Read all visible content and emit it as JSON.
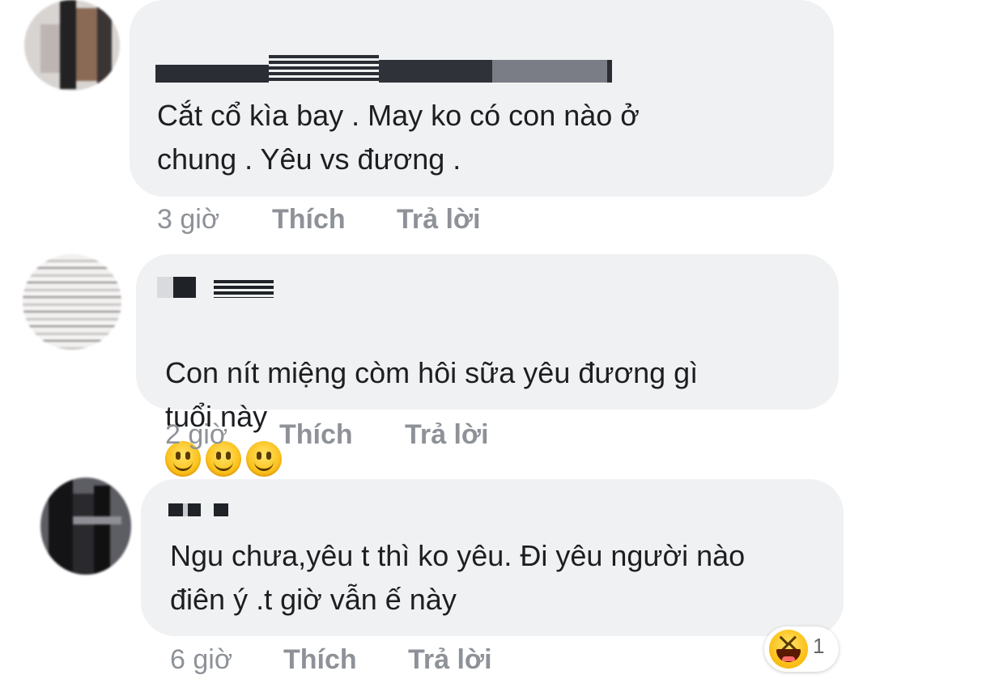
{
  "comments": [
    {
      "text": "Cắt cổ kìa bay . May ko có con nào ở\nchung . Yêu vs đương .",
      "time": "3 giờ",
      "like": "Thích",
      "reply": "Trả lời"
    },
    {
      "text": "Con nít miệng còm hôi sữa yêu đương gì\ntuổi này",
      "emojis": [
        "slightly-smiling-face",
        "slightly-smiling-face",
        "slightly-smiling-face"
      ],
      "time": "2 giờ",
      "like": "Thích",
      "reply": "Trả lời"
    },
    {
      "text": "Ngu chưa,yêu t thì ko yêu. Đi yêu người nào\nđiên ý .t giờ vẫn ế này",
      "time": "6 giờ",
      "like": "Thích",
      "reply": "Trả lời",
      "reaction": {
        "icon": "laughing-face-icon",
        "count": "1"
      }
    }
  ],
  "colors": {
    "bubble": "#f0f1f3",
    "text": "#1c1e21",
    "meta": "#8e9298"
  }
}
